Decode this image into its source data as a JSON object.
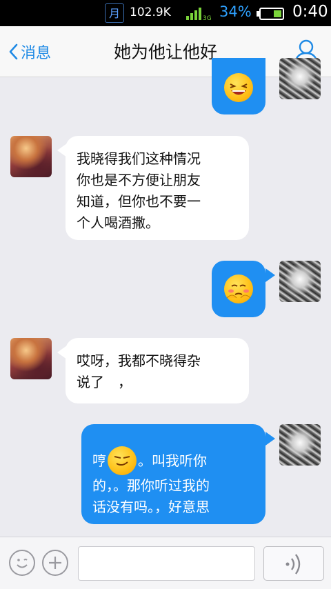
{
  "status_bar": {
    "moon_glyph": "月",
    "net_speed": "102.9K",
    "battery_percent": "34%",
    "time": "0:40",
    "accent_color": "#2ea1ff"
  },
  "nav": {
    "back_label": "消息",
    "title": "她为他让他好",
    "profile_icon": "person-icon"
  },
  "messages": [
    {
      "side": "out",
      "type": "emoji",
      "emoji": "laughing-face-emoji"
    },
    {
      "side": "in",
      "type": "text",
      "lines": [
        "我晓得我们这种情况",
        "你也是不方便让朋友",
        "知道，但你也不要一",
        "个人喝酒撒。"
      ]
    },
    {
      "side": "out",
      "type": "emoji",
      "emoji": "shy-face-emoji"
    },
    {
      "side": "in",
      "type": "text",
      "lines": [
        "哎呀，我都不晓得杂",
        "说了　，"
      ]
    },
    {
      "side": "out",
      "type": "text",
      "lead": "哼",
      "inline_emoji": "smug-face-emoji",
      "lines": [
        "。叫我听你",
        "的，。那你听过我的",
        "话没有吗。，好意思"
      ]
    }
  ],
  "input_bar": {
    "emoji_icon": "smiley-icon",
    "plus_icon": "plus-icon",
    "text_value": "",
    "voice_icon": "voice-icon"
  },
  "colors": {
    "bubble_out": "#1f8ff2",
    "bubble_in": "#ffffff",
    "background": "#ebebf0"
  }
}
